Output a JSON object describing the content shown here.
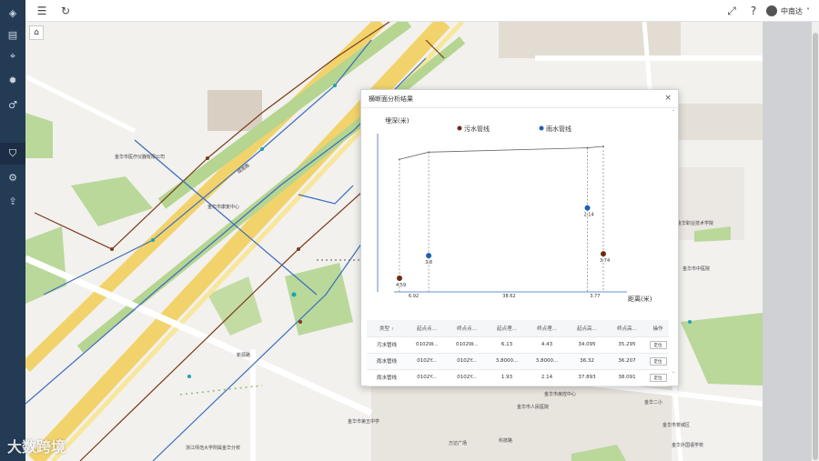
{
  "sidebar": {
    "items": [
      {
        "icon": "layers-icon"
      },
      {
        "icon": "chart-icon"
      },
      {
        "icon": "location-icon"
      },
      {
        "icon": "bug-icon"
      },
      {
        "icon": "pin-icon"
      },
      {
        "icon": "shield-icon"
      },
      {
        "icon": "settings-icon"
      },
      {
        "icon": "export-icon"
      }
    ]
  },
  "topbar": {
    "user_name": "中南达"
  },
  "map_labels": {
    "l1": "金华市医疗仪器有限公司",
    "l2": "金华市康复中心",
    "l3": "城南路",
    "l4": "新源路",
    "l5": "浙江师范大学附属金华分校",
    "l6": "金华市第五中学",
    "l7": "万达广场",
    "l8": "金华市人民医院",
    "l9": "金华市疾控中心",
    "l10": "金华二小",
    "l11": "金华市婺城区",
    "l12": "金华外国语学校",
    "l13": "金华职业技术学院",
    "l14": "金华市中医院",
    "l15": "科技路"
  },
  "dialog": {
    "title": "横断面分析结果",
    "close": "×"
  },
  "chart_data": {
    "type": "scatter",
    "ylabel": "埋深(米)",
    "xlabel": "距离(米)",
    "legend": [
      "污水管线",
      "雨水管线"
    ],
    "colors": {
      "污水管线": "#6b2c14",
      "雨水管线": "#1f5fb5",
      "ground": "#666666"
    },
    "points": [
      {
        "series": "污水管线",
        "x": 0,
        "depth": 4.59,
        "label": "4.59"
      },
      {
        "series": "雨水管线",
        "x": 6.92,
        "depth": 3.8,
        "label": "3.8"
      },
      {
        "series": "雨水管线",
        "x": 44.54,
        "depth": 2.14,
        "label": "2.14"
      },
      {
        "series": "污水管线",
        "x": 48.31,
        "depth": 3.74,
        "label": "3.74"
      }
    ],
    "ground_points": [
      {
        "x": 0,
        "depth": 0.45
      },
      {
        "x": 6.92,
        "depth": 0.2
      },
      {
        "x": 44.54,
        "depth": 0.05
      },
      {
        "x": 48.31,
        "depth": 0.0
      }
    ],
    "segments": [
      {
        "from": 0,
        "to": 6.92,
        "label": "6.92"
      },
      {
        "from": 6.92,
        "to": 44.54,
        "label": "38.62"
      },
      {
        "from": 44.54,
        "to": 48.31,
        "label": "3.77"
      }
    ],
    "xlim": [
      0,
      48.31
    ],
    "ylim": [
      0,
      5
    ]
  },
  "table": {
    "headers": [
      "类型",
      "起点点...",
      "终点点...",
      "起点埋...",
      "终点埋...",
      "起点高...",
      "终点高...",
      "操作"
    ],
    "rows": [
      {
        "type": "污水管线",
        "start_pt": "0102W...",
        "end_pt": "0102W...",
        "start_depth": "6.13",
        "end_depth": "4.43",
        "start_elev": "34.095",
        "end_elev": "35.295",
        "action": "定位"
      },
      {
        "type": "雨水管线",
        "start_pt": "0102Y...",
        "end_pt": "0102Y...",
        "start_depth": "3.8000...",
        "end_depth": "3.8000...",
        "start_elev": "36.32",
        "end_elev": "36.207",
        "action": "定位"
      },
      {
        "type": "雨水管线",
        "start_pt": "0102Y...",
        "end_pt": "0102Y...",
        "start_depth": "1.93",
        "end_depth": "2.14",
        "start_elev": "37.893",
        "end_elev": "38.091",
        "action": "定位"
      }
    ]
  },
  "watermark": "大数跨境"
}
